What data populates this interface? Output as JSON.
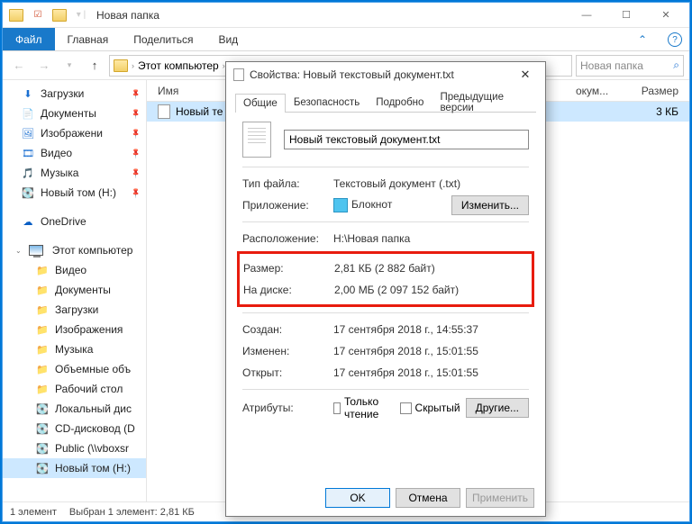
{
  "window": {
    "title": "Новая папка",
    "titlebar_separator": "|"
  },
  "ribbon": {
    "file": "Файл",
    "home": "Главная",
    "share": "Поделиться",
    "view": "Вид"
  },
  "address": {
    "path_root": "Этот компьютер",
    "search_placeholder": "Новая папка"
  },
  "navpane": {
    "quick": [
      {
        "label": "Загрузки",
        "icon": "download"
      },
      {
        "label": "Документы",
        "icon": "doc"
      },
      {
        "label": "Изображени",
        "icon": "pic"
      },
      {
        "label": "Видео",
        "icon": "video"
      },
      {
        "label": "Музыка",
        "icon": "music"
      },
      {
        "label": "Новый том (H:)",
        "icon": "drive"
      }
    ],
    "onedrive": "OneDrive",
    "thispc": "Этот компьютер",
    "thispc_items": [
      {
        "label": "Видео"
      },
      {
        "label": "Документы"
      },
      {
        "label": "Загрузки"
      },
      {
        "label": "Изображения"
      },
      {
        "label": "Музыка"
      },
      {
        "label": "Объемные объ"
      },
      {
        "label": "Рабочий стол"
      },
      {
        "label": "Локальный дис"
      },
      {
        "label": "CD-дисковод (D"
      },
      {
        "label": "Public (\\\\vboxsr"
      },
      {
        "label": "Новый том (H:)"
      }
    ]
  },
  "list": {
    "col_name": "Имя",
    "col_size": "Размер",
    "row_ext": "окум...",
    "rows": [
      {
        "name": "Новый те",
        "size": "3 КБ"
      }
    ]
  },
  "statusbar": {
    "count": "1 элемент",
    "selection": "Выбран 1 элемент: 2,81 КБ"
  },
  "dialog": {
    "title": "Свойства: Новый текстовый документ.txt",
    "tabs": {
      "general": "Общие",
      "security": "Безопасность",
      "details": "Подробно",
      "previous": "Предыдущие версии"
    },
    "filename": "Новый текстовый документ.txt",
    "labels": {
      "type": "Тип файла:",
      "app": "Приложение:",
      "location": "Расположение:",
      "size": "Размер:",
      "ondisk": "На диске:",
      "created": "Создан:",
      "modified": "Изменен:",
      "accessed": "Открыт:",
      "attributes": "Атрибуты:",
      "readonly": "Только чтение",
      "hidden": "Скрытый",
      "change": "Изменить...",
      "other": "Другие..."
    },
    "values": {
      "type": "Текстовый документ (.txt)",
      "app": "Блокнот",
      "location": "H:\\Новая папка",
      "size": "2,81 КБ (2 882 байт)",
      "ondisk": "2,00 МБ (2 097 152 байт)",
      "created": "17 сентября 2018 г., 14:55:37",
      "modified": "17 сентября 2018 г., 15:01:55",
      "accessed": "17 сентября 2018 г., 15:01:55"
    },
    "buttons": {
      "ok": "OK",
      "cancel": "Отмена",
      "apply": "Применить"
    }
  }
}
